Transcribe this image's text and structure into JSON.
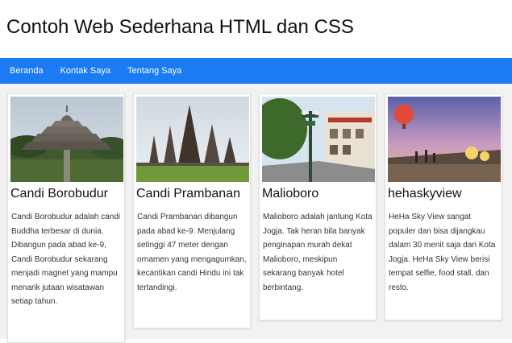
{
  "page": {
    "title": "Contoh Web Sederhana HTML dan CSS"
  },
  "nav": {
    "items": [
      {
        "label": "Beranda"
      },
      {
        "label": "Kontak Saya"
      },
      {
        "label": "Tentang Saya"
      }
    ]
  },
  "cards": [
    {
      "title": "Candi Borobudur",
      "text": "Candi Borobudur adalah candi Buddha terbesar di dunia. Dibangun pada abad ke-9, Candi Borobudur sekarang menjadi magnet yang mampu menarik jutaan wisatawan setiap tahun."
    },
    {
      "title": "Candi Prambanan",
      "text": "Candi Prambanan dibangun pada abad ke-9. Menjulang setinggi 47 meter dengan ornamen yang mengagumkan, kecantikan candi Hindu ini tak tertandingi."
    },
    {
      "title": "Malioboro",
      "text": "Malioboro adalah jantung Kota Jogja. Tak heran bila banyak penginapan murah dekat Malioboro, meskipun sekarang banyak hotel berbintang."
    },
    {
      "title": "hehaskyview",
      "text": "HeHa Sky View sangat populer dan bisa dijangkau dalam 30 menit saja dari Kota Jogja. HeHa Sky View berisi tempat selfie, food stall, dan resto."
    }
  ],
  "colors": {
    "nav_bg": "#1a7bf2",
    "nav_text": "#ffffff",
    "content_bg": "#f2f2f2"
  }
}
